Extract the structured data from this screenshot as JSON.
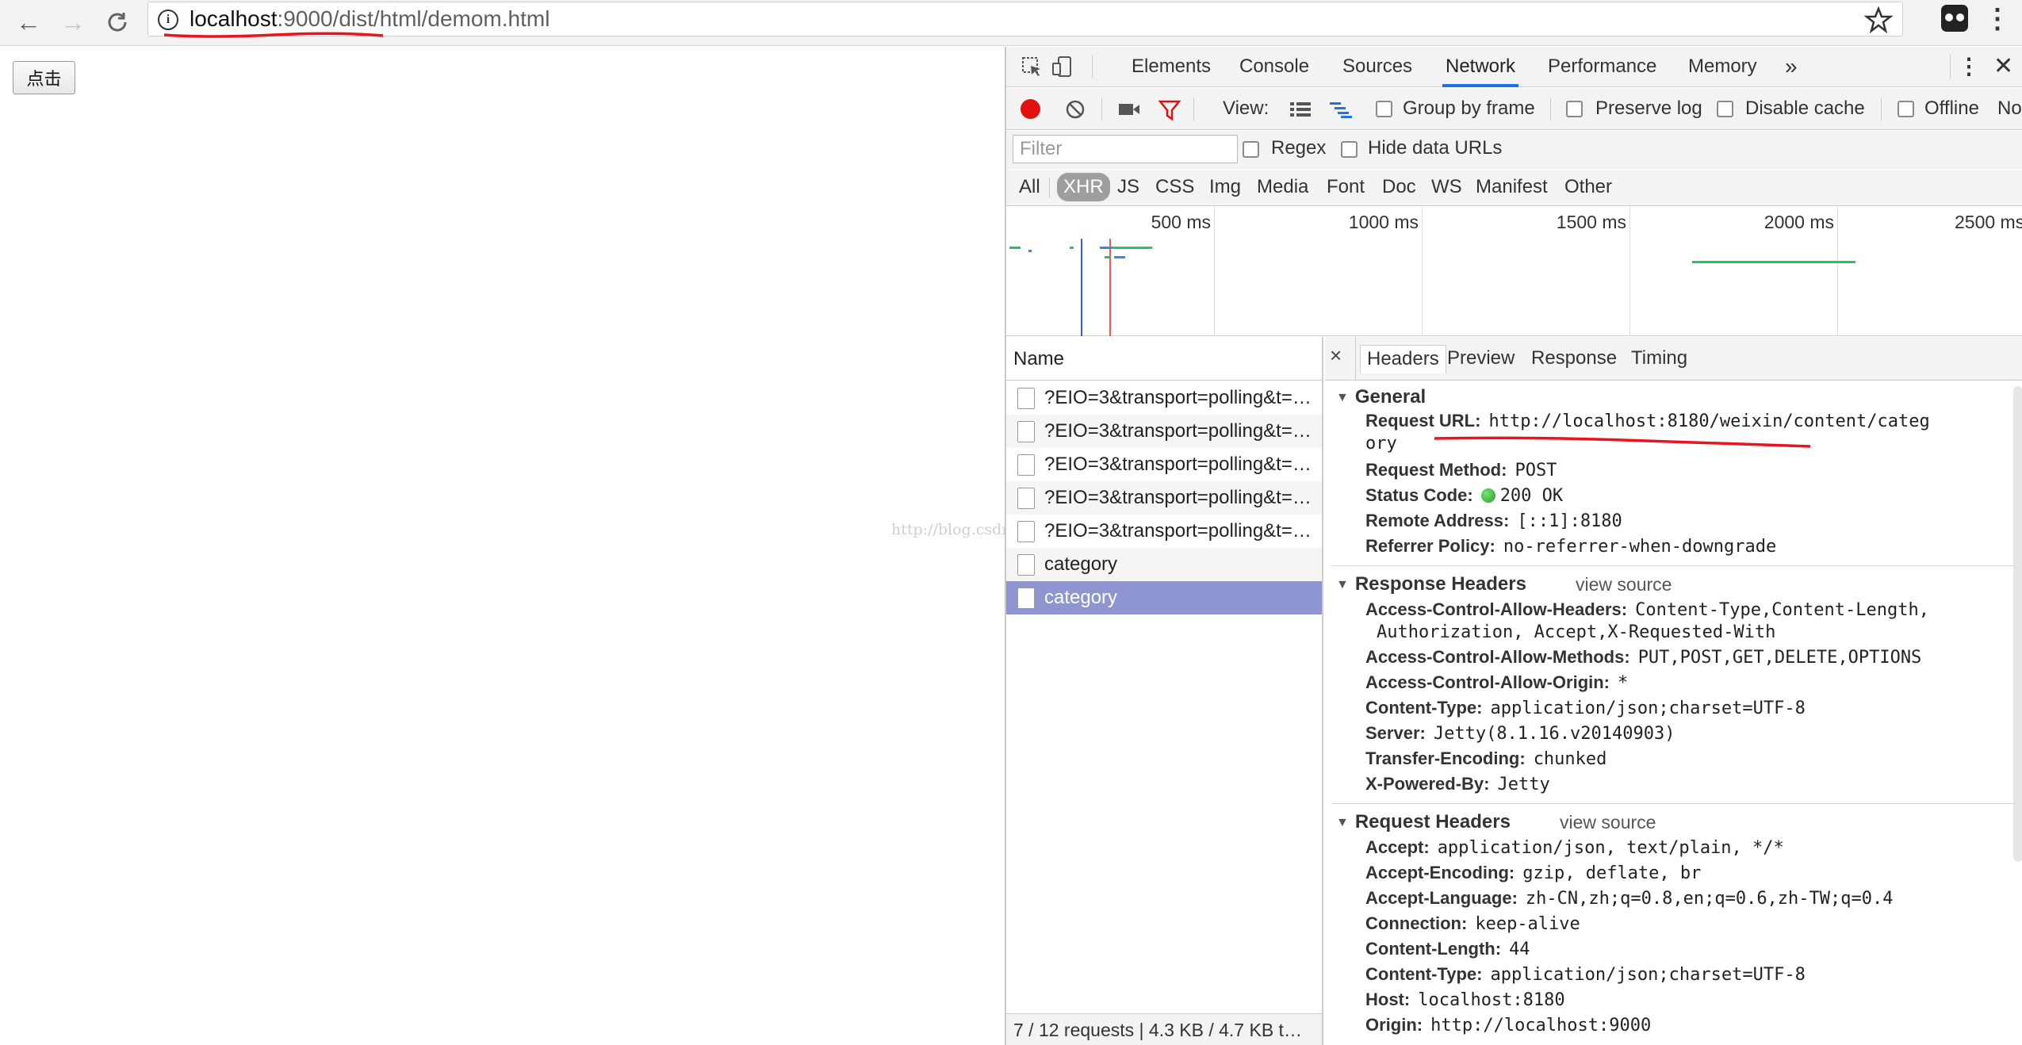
{
  "browser": {
    "url_host": "localhost",
    "url_rest": ":9000/dist/html/demom.html"
  },
  "page": {
    "button_label": "点击",
    "watermark": "http://blog.csdn.net/"
  },
  "devtools": {
    "tabs": [
      "Elements",
      "Console",
      "Sources",
      "Network",
      "Performance",
      "Memory"
    ],
    "active_tab": "Network",
    "toolbar": {
      "view_label": "View:",
      "group_by_frame": "Group by frame",
      "preserve_log": "Preserve log",
      "disable_cache": "Disable cache",
      "offline": "Offline",
      "no_throttling": "No"
    },
    "filter": {
      "placeholder": "Filter",
      "regex": "Regex",
      "hide_data_urls": "Hide data URLs"
    },
    "types": [
      "All",
      "XHR",
      "JS",
      "CSS",
      "Img",
      "Media",
      "Font",
      "Doc",
      "WS",
      "Manifest",
      "Other"
    ],
    "active_type": "XHR",
    "overview_ticks": [
      "500 ms",
      "1000 ms",
      "1500 ms",
      "2000 ms",
      "2500 ms"
    ],
    "colors": {
      "selected_row": "#8e95d0",
      "active_tab_underline": "#1a73e8",
      "record_red": "#e0110f",
      "timeline_green": "#22c55e",
      "annotation_red": "#e8141e"
    },
    "requests": {
      "header": "Name",
      "rows": [
        "?EIO=3&transport=polling&t=…",
        "?EIO=3&transport=polling&t=…",
        "?EIO=3&transport=polling&t=…",
        "?EIO=3&transport=polling&t=…",
        "?EIO=3&transport=polling&t=…",
        "category",
        "category"
      ],
      "selected_index": 6,
      "footer": "7 / 12 requests | 4.3 KB / 4.7 KB t…"
    },
    "details": {
      "tabs": [
        "Headers",
        "Preview",
        "Response",
        "Timing"
      ],
      "active_tab": "Headers",
      "general": {
        "title": "General",
        "request_url_key": "Request URL:",
        "request_url_line1": "http://localhost:8180/weixin/content/categ",
        "request_url_line2": "ory",
        "request_method_key": "Request Method:",
        "request_method": "POST",
        "status_code_key": "Status Code:",
        "status_code": "200 OK",
        "remote_address_key": "Remote Address:",
        "remote_address": "[::1]:8180",
        "referrer_policy_key": "Referrer Policy:",
        "referrer_policy": "no-referrer-when-downgrade"
      },
      "response_headers": {
        "title": "Response Headers",
        "view_source": "view source",
        "acah_key": "Access-Control-Allow-Headers:",
        "acah_line1": "Content-Type,Content-Length,",
        "acah_line2": "Authorization, Accept,X-Requested-With",
        "acam_key": "Access-Control-Allow-Methods:",
        "acam": "PUT,POST,GET,DELETE,OPTIONS",
        "acao_key": "Access-Control-Allow-Origin:",
        "acao": "*",
        "ct_key": "Content-Type:",
        "ct": "application/json;charset=UTF-8",
        "server_key": "Server:",
        "server": "Jetty(8.1.16.v20140903)",
        "te_key": "Transfer-Encoding:",
        "te": "chunked",
        "xpb_key": "X-Powered-By:",
        "xpb": "Jetty"
      },
      "request_headers": {
        "title": "Request Headers",
        "view_source": "view source",
        "accept_key": "Accept:",
        "accept": "application/json, text/plain, */*",
        "ae_key": "Accept-Encoding:",
        "ae": "gzip, deflate, br",
        "al_key": "Accept-Language:",
        "al": "zh-CN,zh;q=0.8,en;q=0.6,zh-TW;q=0.4",
        "conn_key": "Connection:",
        "conn": "keep-alive",
        "cl_key": "Content-Length:",
        "cl": "44",
        "ct_key": "Content-Type:",
        "ct": "application/json;charset=UTF-8",
        "host_key": "Host:",
        "host": "localhost:8180",
        "origin_key": "Origin:",
        "origin": "http://localhost:9000"
      }
    }
  }
}
